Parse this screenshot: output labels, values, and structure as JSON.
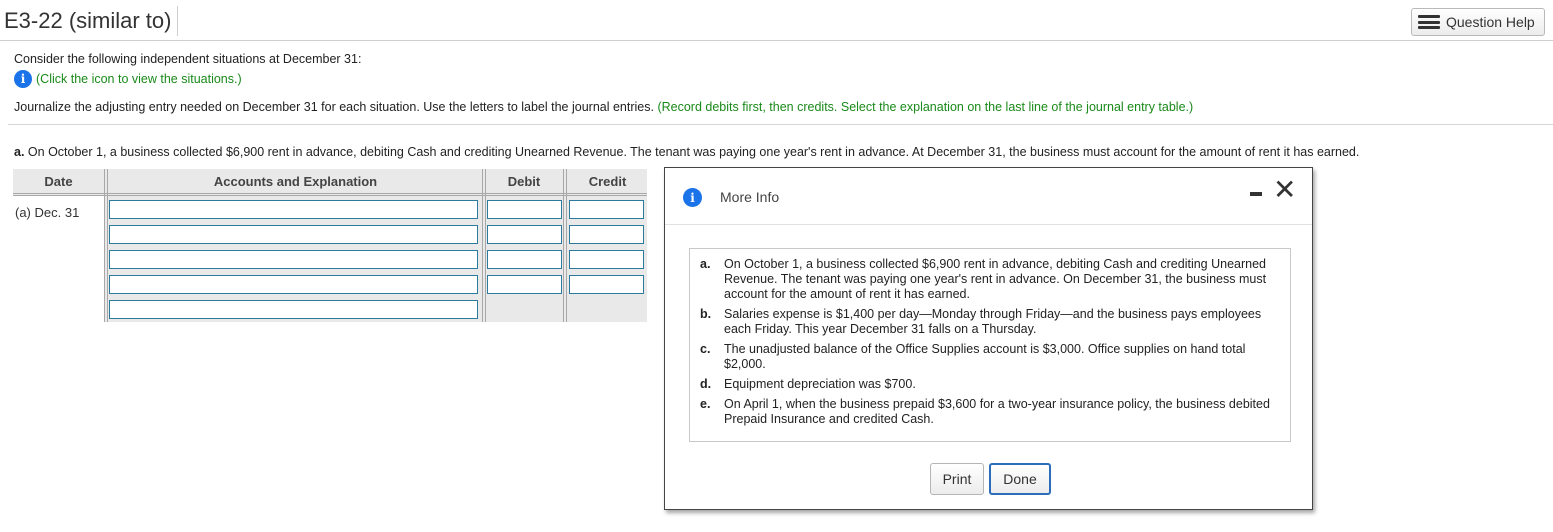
{
  "header": {
    "title": "E3-22 (similar to)",
    "help_label": "Question Help"
  },
  "question": {
    "intro": "Consider the following independent situations at December 31:",
    "info_link": "(Click the icon to view the situations.)",
    "instruction": "Journalize the adjusting entry needed on December 31 for each situation. Use the letters to label the journal entries.",
    "instruction_note": "(Record debits first, then credits. Select the explanation on the last line of the journal entry table.)",
    "situation_letter": "a.",
    "situation_text": "On October 1, a business collected $6,900 rent in advance, debiting Cash and crediting Unearned Revenue. The tenant was paying one year's rent in advance. At December 31, the business must account for the amount of rent it has earned."
  },
  "journal": {
    "headers": [
      "Date",
      "Accounts and Explanation",
      "Debit",
      "Credit"
    ],
    "date_label": "(a) Dec. 31"
  },
  "modal": {
    "title": "More Info",
    "items": [
      {
        "letter": "a.",
        "text": "On October 1, a business collected $6,900 rent in advance, debiting Cash and crediting Unearned Revenue. The tenant was paying one year's rent in advance. On December 31, the business must account for the amount of rent it has earned."
      },
      {
        "letter": "b.",
        "text": "Salaries expense is $1,400 per day—Monday through Friday—and the business pays employees each Friday. This year December 31 falls on a Thursday."
      },
      {
        "letter": "c.",
        "text": "The unadjusted balance of the Office Supplies account is $3,000. Office supplies on hand total $2,000."
      },
      {
        "letter": "d.",
        "text": "Equipment depreciation was $700."
      },
      {
        "letter": "e.",
        "text": "On April 1, when the business prepaid $3,600 for a two-year insurance policy, the business debited Prepaid Insurance and credited Cash."
      }
    ],
    "print_label": "Print",
    "done_label": "Done"
  },
  "colors": {
    "accent_blue": "#1a73e8",
    "note_green": "#1a8a1a",
    "input_border": "#2c7a9e"
  },
  "icons": {
    "help": "list-icon",
    "info": "info-icon",
    "minimize": "minimize-icon",
    "close": "close-icon"
  }
}
